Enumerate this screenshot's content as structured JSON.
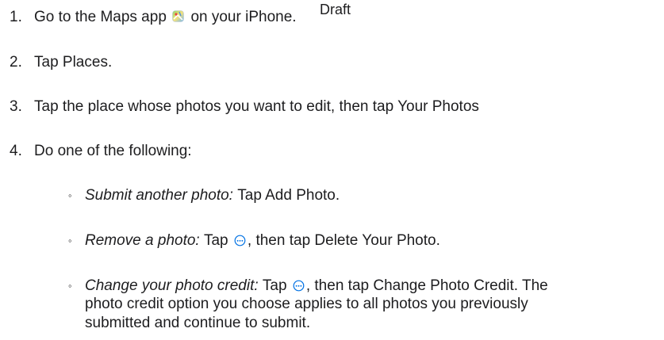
{
  "watermark": "Draft",
  "steps": [
    {
      "number": "1.",
      "text_before": "Go to the Maps app",
      "icon": "maps-app-icon",
      "text_after": "on your iPhone."
    },
    {
      "number": "2.",
      "text": "Tap Places."
    },
    {
      "number": "3.",
      "text": "Tap the place whose photos you want to edit, then tap Your Photos"
    },
    {
      "number": "4.",
      "text": "Do one of the following:"
    }
  ],
  "sub_items": [
    {
      "bullet": "◦",
      "label": "Submit another photo:",
      "text": "Tap Add Photo."
    },
    {
      "bullet": "◦",
      "label": "Remove a photo:",
      "text_before": "Tap",
      "icon": "more-options-icon",
      "text_after": ", then tap Delete Your Photo."
    },
    {
      "bullet": "◦",
      "label": "Change your photo credit:",
      "text_before": "Tap",
      "icon": "more-options-icon",
      "text_after": ", then tap Change Photo Credit. The",
      "continuation": [
        "photo credit option you choose applies to all photos you previously",
        "submitted and continue to submit."
      ]
    }
  ],
  "colors": {
    "text": "#1d1d1f",
    "icon_accent": "#0071e3"
  }
}
